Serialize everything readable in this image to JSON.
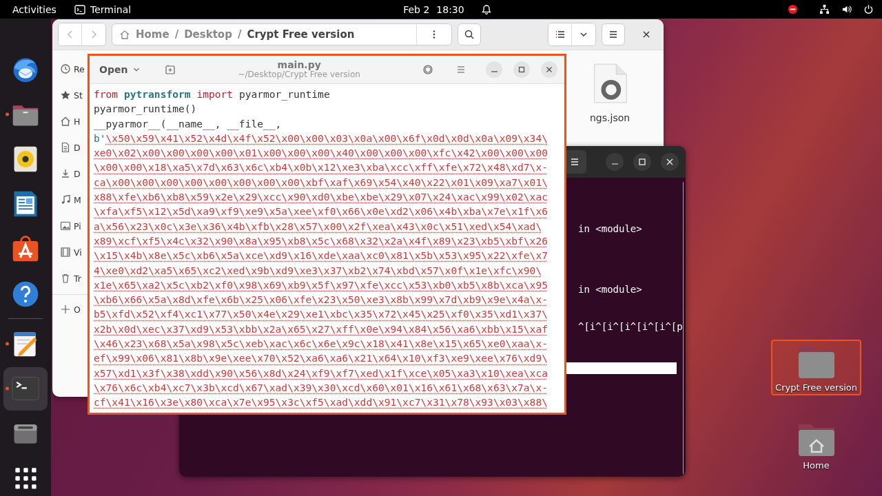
{
  "top_bar": {
    "activities": "Activities",
    "app_name": "Terminal",
    "date": "Feb 2",
    "time": "18:30"
  },
  "dock": {
    "items": [
      {
        "kind": "mail",
        "running": false,
        "selected": false
      },
      {
        "kind": "folder",
        "running": true,
        "selected": false
      },
      {
        "kind": "speaker",
        "running": false,
        "selected": false
      },
      {
        "kind": "document",
        "running": false,
        "selected": false
      },
      {
        "kind": "store",
        "running": false,
        "selected": false
      },
      {
        "kind": "help",
        "running": false,
        "selected": false
      },
      {
        "kind": "separator"
      },
      {
        "kind": "editor",
        "running": true,
        "selected": false
      },
      {
        "kind": "terminal",
        "running": true,
        "selected": true
      },
      {
        "kind": "drive",
        "running": false,
        "selected": false
      },
      {
        "kind": "grid",
        "running": false,
        "selected": false
      }
    ]
  },
  "files_window": {
    "path": [
      {
        "kind": "crumb",
        "text": "Home"
      },
      {
        "kind": "sep",
        "text": "/"
      },
      {
        "kind": "crumb",
        "text": "Desktop"
      },
      {
        "kind": "sep",
        "text": "/"
      },
      {
        "kind": "current",
        "text": "Crypt Free version"
      }
    ],
    "sidebar": [
      {
        "kind": "recent",
        "label": "Re"
      },
      {
        "kind": "starred",
        "label": "St"
      },
      {
        "kind": "home",
        "label": "H"
      },
      {
        "kind": "documents",
        "label": "D"
      },
      {
        "kind": "downloads",
        "label": "D"
      },
      {
        "kind": "music",
        "label": "M"
      },
      {
        "kind": "pictures",
        "label": "Pi"
      },
      {
        "kind": "videos",
        "label": "Vi"
      },
      {
        "kind": "trash",
        "label": "Tr"
      },
      {
        "kind": "other",
        "label": "O"
      }
    ],
    "files": [
      {
        "name": "ngs.json"
      }
    ]
  },
  "terminal_window": {
    "lines": [
      {
        "kind": "text",
        "text": "in <module>"
      },
      {
        "kind": "text",
        "text": "in <module>"
      },
      {
        "kind": "text",
        "text": "^[i^[i^[i^[i^[i^[p"
      },
      {
        "kind": "highlight"
      }
    ]
  },
  "editor": {
    "open_label": "Open",
    "title": "main.py",
    "subtitle": "~/Desktop/Crypt Free version",
    "lines": [
      [
        {
          "kind": "keyword",
          "text": "from"
        },
        {
          "kind": "module",
          "text": " pytransform"
        },
        {
          "kind": "keyword",
          "text": " import"
        },
        {
          "kind": "plain",
          "text": " pyarmor_runtime"
        }
      ],
      [
        {
          "kind": "plain",
          "text": "pyarmor_runtime()"
        }
      ],
      [
        {
          "kind": "plain",
          "text": "__pyarmor__(__name__, __file__,"
        }
      ],
      [
        {
          "kind": "prefix",
          "text": "b'"
        },
        {
          "kind": "string",
          "text": "\\x50\\x59\\x41\\x52\\x4d\\x4f\\x52\\x00\\x00\\x03\\x0a\\x00\\x6f\\x0d\\x0d\\x0a\\x09\\x34\\"
        }
      ],
      [
        {
          "kind": "string",
          "text": "xe0\\x02\\x00\\x00\\x00\\x00\\x01\\x00\\x00\\x00\\x40\\x00\\x00\\x00\\xfc\\x42\\x00\\x00\\x00"
        }
      ],
      [
        {
          "kind": "string",
          "text": "\\x00\\x00\\x18\\xa5\\x7d\\x63\\x6c\\xb4\\x0b\\x12\\xe3\\xba\\xcc\\xff\\xfe\\x72\\x48\\xd7\\x-"
        }
      ],
      [
        {
          "kind": "string",
          "text": "ca\\x00\\x00\\x00\\x00\\x00\\x00\\x00\\x00\\xbf\\xaf\\x69\\x54\\x40\\x22\\x01\\x09\\xa7\\x01\\"
        }
      ],
      [
        {
          "kind": "string",
          "text": "x88\\xfe\\xb6\\xb8\\x59\\x2e\\x29\\xcc\\x90\\xd0\\xbe\\xbe\\x29\\x07\\x24\\xac\\x99\\x02\\xac"
        }
      ],
      [
        {
          "kind": "string",
          "text": "\\xfa\\xf5\\x12\\x5d\\xa9\\xf9\\xe9\\x5a\\xee\\xf0\\x66\\x0e\\xd2\\x06\\x4b\\xba\\x7e\\x1f\\x6"
        }
      ],
      [
        {
          "kind": "string",
          "text": "a\\x56\\x23\\x0c\\x3e\\x36\\x4b\\xfb\\x28\\x57\\x00\\x2f\\xea\\x43\\x0c\\x51\\xed\\x54\\xad\\"
        }
      ],
      [
        {
          "kind": "string",
          "text": "x89\\xcf\\xf5\\x4c\\x32\\x90\\x8a\\x95\\xb8\\x5c\\x68\\x32\\x2a\\x4f\\x89\\x23\\xb5\\xbf\\x26"
        }
      ],
      [
        {
          "kind": "string",
          "text": "\\x15\\x4b\\x8e\\x5c\\xb6\\x5a\\xce\\xd9\\x16\\xde\\xaa\\xc0\\x81\\x5b\\x53\\x95\\x22\\xfe\\x7"
        }
      ],
      [
        {
          "kind": "string",
          "text": "4\\xe0\\xd2\\xa5\\x65\\xc2\\xed\\x9b\\xd9\\xe3\\x37\\xb2\\x74\\xbd\\x57\\x0f\\x1e\\xfc\\x90\\"
        }
      ],
      [
        {
          "kind": "string",
          "text": "x1e\\x65\\xa2\\x5c\\xb2\\xf0\\x98\\x69\\xb9\\x5f\\x97\\xfe\\xcc\\x53\\xb0\\xb5\\x8b\\xca\\x95"
        }
      ],
      [
        {
          "kind": "string",
          "text": "\\xb6\\x66\\x5a\\x8d\\xfe\\x6b\\x25\\x06\\xfe\\x23\\x50\\xe3\\x8b\\x99\\x7d\\xb9\\x9e\\x4a\\x-"
        }
      ],
      [
        {
          "kind": "string",
          "text": "b5\\xfd\\x52\\xf4\\xc1\\x77\\x50\\x4e\\x29\\xe1\\xbc\\x35\\x72\\x45\\x25\\xf0\\x35\\xd1\\x37\\"
        }
      ],
      [
        {
          "kind": "string",
          "text": "x2b\\x0d\\xec\\x37\\xd9\\x53\\xbb\\x2a\\x65\\x27\\xff\\x0e\\x94\\x84\\x56\\xa6\\xbb\\x15\\xaf"
        }
      ],
      [
        {
          "kind": "string",
          "text": "\\x46\\x23\\x68\\x5a\\x98\\x5c\\xeb\\xac\\x6c\\x6e\\x9c\\x18\\x41\\x8e\\x15\\x65\\xe0\\xaa\\x-"
        }
      ],
      [
        {
          "kind": "string",
          "text": "ef\\x99\\x06\\x81\\x8b\\x9e\\xee\\x70\\x52\\xa6\\xa6\\x21\\x64\\x10\\xf3\\xe9\\xee\\x76\\xd9\\"
        }
      ],
      [
        {
          "kind": "string",
          "text": "x57\\xd1\\x3f\\x38\\xdd\\x90\\x56\\x8d\\x24\\xf9\\xf7\\xed\\x1f\\xce\\x05\\xa3\\x10\\xea\\xca"
        }
      ],
      [
        {
          "kind": "string",
          "text": "\\x76\\x6c\\xb4\\xc7\\x3b\\xcd\\x67\\xad\\x39\\x30\\xcd\\x60\\x01\\x16\\x61\\x68\\x63\\x7a\\x-"
        }
      ],
      [
        {
          "kind": "string",
          "text": "cf\\x41\\x16\\x3e\\x80\\xca\\x7e\\x95\\x3c\\xf5\\xad\\xdd\\x91\\xc7\\x31\\x78\\x93\\x03\\x88\\"
        }
      ]
    ]
  },
  "desktop_icons": [
    {
      "kind": "folder",
      "label": "Crypt Free version",
      "selected": true
    },
    {
      "kind": "home",
      "label": "Home",
      "selected": false
    }
  ]
}
